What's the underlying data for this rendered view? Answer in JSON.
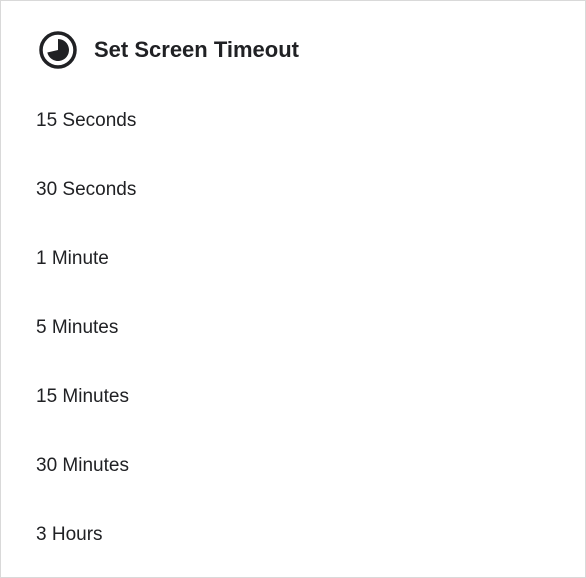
{
  "dialog": {
    "title": "Set Screen Timeout",
    "icon": "timer-icon"
  },
  "options": [
    {
      "label": "15 Seconds"
    },
    {
      "label": "30 Seconds"
    },
    {
      "label": "1 Minute"
    },
    {
      "label": "5 Minutes"
    },
    {
      "label": "15 Minutes"
    },
    {
      "label": "30 Minutes"
    },
    {
      "label": "3 Hours"
    }
  ],
  "colors": {
    "text": "#202124",
    "background": "#ffffff"
  }
}
